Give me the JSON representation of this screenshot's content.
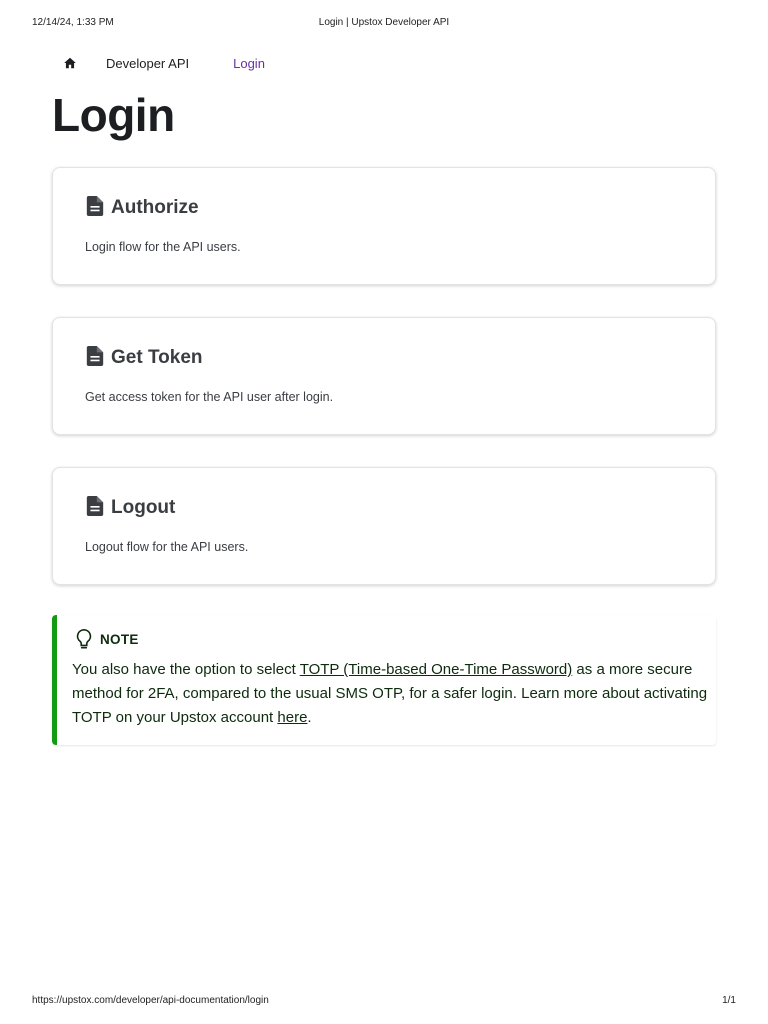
{
  "print_header": {
    "date": "12/14/24, 1:33 PM",
    "title": "Login | Upstox Developer API"
  },
  "print_footer": {
    "url": "https://upstox.com/developer/api-documentation/login",
    "pages": "1/1"
  },
  "breadcrumbs": {
    "home_icon": "home-icon",
    "items": [
      {
        "label": "Developer API"
      },
      {
        "label": "Login"
      }
    ]
  },
  "page_title": "Login",
  "cards": [
    {
      "icon": "document-icon",
      "title": "Authorize",
      "description": "Login flow for the API users."
    },
    {
      "icon": "document-icon",
      "title": "Get Token",
      "description": "Get access token for the API user after login."
    },
    {
      "icon": "document-icon",
      "title": "Logout",
      "description": "Logout flow for the API users."
    }
  ],
  "note": {
    "icon": "lightbulb-icon",
    "heading": "NOTE",
    "text_1": "You also have the option to select ",
    "link_1": "TOTP (Time-based One-Time Password)",
    "text_2": " as a more secure method for 2FA, compared to the usual SMS OTP, for a safer login. Learn more about activating TOTP on your Upstox account ",
    "link_2": "here",
    "text_3": "."
  },
  "colors": {
    "active_breadcrumb": "#6b2fa3",
    "note_border": "#139a13",
    "note_text": "#0d2b0d"
  }
}
